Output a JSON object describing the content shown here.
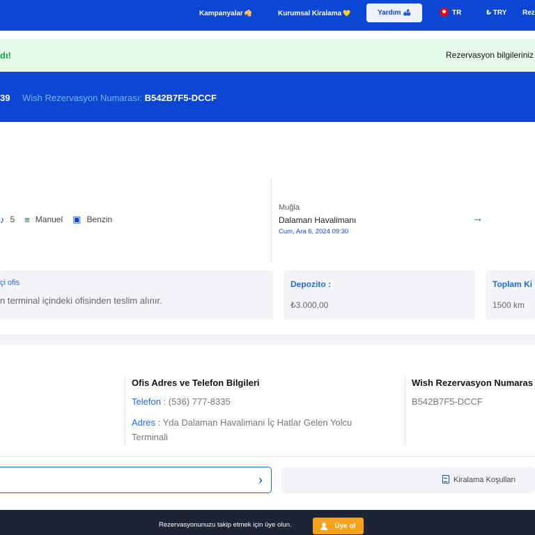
{
  "nav": {
    "campaigns": "Kampanyalar",
    "campaigns_emoji": "🥠",
    "corporate": "Kurumsal Kiralama",
    "corporate_emoji": "💛",
    "help": "Yardım",
    "help_emoji": "🛋",
    "language": "TR",
    "currency": "₺ TRY",
    "reservation": "Reze"
  },
  "banner": {
    "success_text": "dı!",
    "info_text": "Rezervasyon bilgileriniz"
  },
  "reservation": {
    "code_fragment": "39",
    "wish_label": "Wish Rezervasyon Numarası:",
    "wish_number": "B542B7F5-DCCF"
  },
  "car": {
    "seats": "5",
    "transmission": "Manuel",
    "fuel": "Benzin"
  },
  "dropoff": {
    "city": "Muğla",
    "location": "Dalaman Havalimanı",
    "datetime": "Cum, Ara 6, 2024 09:30"
  },
  "cards": {
    "office_title": "çi ofis",
    "office_text": "n terminal içindeki ofisinden teslim alınır.",
    "deposit_title": "Depozito :",
    "deposit_value": "₺3.000,00",
    "total_title": "Toplam Ki",
    "total_value": "1500 km"
  },
  "contact": {
    "office_title": "Ofis Adres ve Telefon Bilgileri",
    "phone_label": "Telefon :",
    "phone_value": "(536) 777-8335",
    "address_label": "Adres :",
    "address_value": "Yda Dalaman Havalimani İç Hatlar Gelen Yolcu Terminali",
    "wish_title": "Wish Rezervasyon Numaras",
    "wish_value": "B542B7F5-DCCF"
  },
  "actions": {
    "terms": "Kiralama Koşulları"
  },
  "footer": {
    "text": "Rezervasyonunuzu takip etmek için üye olun.",
    "signup": "Üye ol"
  },
  "colors": {
    "brand_blue": "#0b47d4",
    "success_green": "#15a34a",
    "accent_orange": "#f7a21b"
  }
}
